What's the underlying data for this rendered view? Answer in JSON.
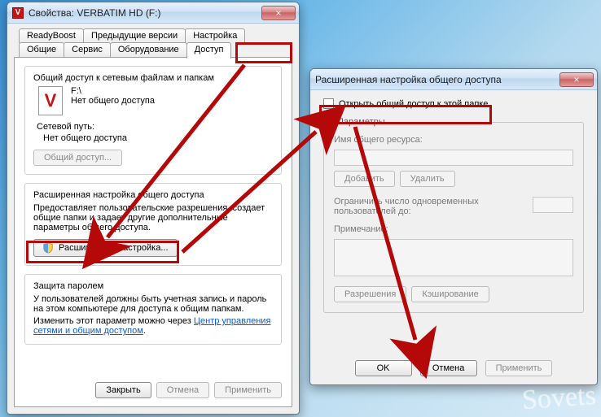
{
  "win1": {
    "title": "Свойства: VERBATIM HD (F:)",
    "tabs_row1": [
      "ReadyBoost",
      "Предыдущие версии",
      "Настройка"
    ],
    "tabs_row2": [
      "Общие",
      "Сервис",
      "Оборудование",
      "Доступ"
    ],
    "share_section_title": "Общий доступ к сетевым файлам и папкам",
    "drive_path": "F:\\",
    "drive_status": "Нет общего доступа",
    "netpath_label": "Сетевой путь:",
    "netpath_value": "Нет общего доступа",
    "share_btn": "Общий доступ...",
    "adv_title": "Расширенная настройка общего доступа",
    "adv_desc": "Предоставляет пользовательские разрешения, создает общие папки и задает другие дополнительные параметры общего доступа.",
    "adv_btn": "Расширенная настройка...",
    "pwd_title": "Защита паролем",
    "pwd_desc_a": "У пользователей должны быть учетная запись и пароль на этом компьютере для доступа к общим папкам.",
    "pwd_desc_b": "Изменить этот параметр можно через ",
    "pwd_link": "Центр управления сетями и общим доступом",
    "footer": {
      "close": "Закрыть",
      "cancel": "Отмена",
      "apply": "Применить"
    }
  },
  "win2": {
    "title": "Расширенная настройка общего доступа",
    "open_share": "Открыть общий доступ к этой папке",
    "group_legend": "Параметры",
    "share_name_label": "Имя общего ресурса:",
    "add_btn": "Добавить",
    "del_btn": "Удалить",
    "limit_label_a": "Ограничить число одновременных",
    "limit_label_b": "пользователей до:",
    "note_label": "Примечание:",
    "perm_btn": "Разрешения",
    "cache_btn": "Кэширование",
    "footer": {
      "ok": "OK",
      "cancel": "Отмена",
      "apply": "Применить"
    }
  },
  "watermark": "Sovets"
}
